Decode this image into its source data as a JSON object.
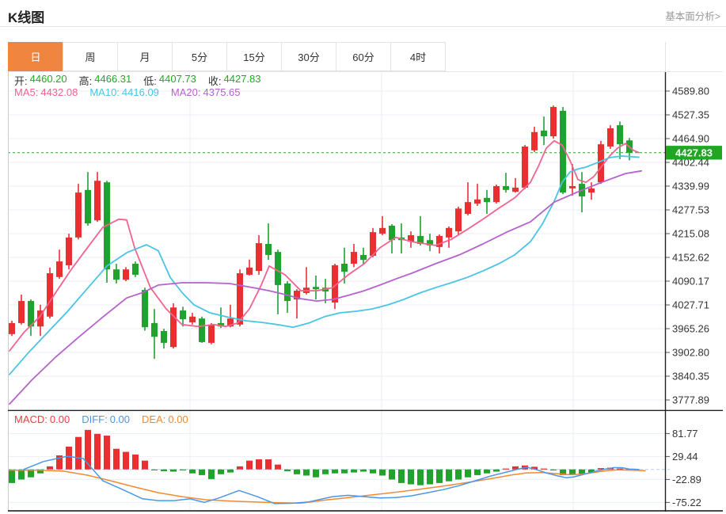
{
  "header": {
    "title": "K线图",
    "link": "基本面分析>"
  },
  "tabs": {
    "items": [
      {
        "id": "daily",
        "label": "日",
        "active": true
      },
      {
        "id": "weekly",
        "label": "周",
        "active": false
      },
      {
        "id": "monthly",
        "label": "月",
        "active": false
      },
      {
        "id": "5min",
        "label": "5分",
        "active": false
      },
      {
        "id": "15min",
        "label": "15分",
        "active": false
      },
      {
        "id": "30min",
        "label": "30分",
        "active": false
      },
      {
        "id": "60min",
        "label": "60分",
        "active": false
      },
      {
        "id": "4hour",
        "label": "4时",
        "active": false
      }
    ]
  },
  "overlay": {
    "ohlc": [
      {
        "label": "开:",
        "value": "4460.20"
      },
      {
        "label": "高:",
        "value": "4466.31"
      },
      {
        "label": "低:",
        "value": "4407.73"
      },
      {
        "label": "收:",
        "value": "4427.83"
      }
    ],
    "ma": [
      {
        "label": "MA5:",
        "value": "4432.08"
      },
      {
        "label": "MA10:",
        "value": "4416.09"
      },
      {
        "label": "MA20:",
        "value": "4375.65"
      }
    ],
    "macd": [
      {
        "label": "MACD:",
        "value": "0.00"
      },
      {
        "label": "DIFF:",
        "value": "0.00"
      },
      {
        "label": "DEA:",
        "value": "0.00"
      }
    ]
  },
  "colors": {
    "up": "#e93030",
    "down": "#1fa32b",
    "ma5": "#f2638f",
    "ma10": "#49c4e4",
    "ma20": "#b562cc",
    "diff": "#4a97ea",
    "dea": "#f28a33",
    "macd_label": "#e94040",
    "ohlc_value": "#22a822",
    "price_tag_bg": "#21a621",
    "price_line": "#2ca52c",
    "tab_active_bg": "#f0853f",
    "zero_line": "#b5d2ee",
    "grid": "#e9eef6"
  },
  "chart_data": {
    "type": "candlestick",
    "title": "K线图",
    "legend_position": "top-left-overlay",
    "grid": true,
    "main": {
      "y_ticks": [
        4589.8,
        4527.35,
        4464.9,
        4402.44,
        4339.99,
        4277.53,
        4215.08,
        4152.62,
        4090.17,
        4027.71,
        3965.26,
        3902.8,
        3840.35,
        3777.89
      ],
      "ylim": [
        3745,
        4612
      ],
      "last_price": 4427.83,
      "last_price_label": "4427.83",
      "ohlc_current": {
        "open": 4460.2,
        "high": 4466.31,
        "low": 4407.73,
        "close": 4427.83
      },
      "ma_values": {
        "ma5": 4432.08,
        "ma10": 4416.09,
        "ma20": 4375.65
      },
      "candles": [
        [
          3951,
          3986,
          3946,
          3980
        ],
        [
          3980,
          4055,
          3976,
          4038
        ],
        [
          4038,
          4042,
          3946,
          3971
        ],
        [
          3971,
          4028,
          3946,
          4013
        ],
        [
          3997,
          4126,
          3992,
          4111
        ],
        [
          4101,
          4173,
          4096,
          4142
        ],
        [
          4132,
          4215,
          4121,
          4205
        ],
        [
          4205,
          4346,
          4200,
          4323
        ],
        [
          4330,
          4377,
          4236,
          4242
        ],
        [
          4250,
          4377,
          4246,
          4354
        ],
        [
          4350,
          4354,
          4086,
          4121
        ],
        [
          4121,
          4136,
          4084,
          4094
        ],
        [
          4094,
          4127,
          4090,
          4121
        ],
        [
          4136,
          4142,
          4101,
          4107
        ],
        [
          4067,
          4073,
          3960,
          3969
        ],
        [
          3980,
          4017,
          3886,
          3944
        ],
        [
          3959,
          3965,
          3913,
          3928
        ],
        [
          3917,
          4032,
          3913,
          4021
        ],
        [
          4013,
          4023,
          3971,
          3990
        ],
        [
          3982,
          4007,
          3976,
          3997
        ],
        [
          3992,
          3997,
          3928,
          3930
        ],
        [
          3928,
          3980,
          3924,
          3976
        ],
        [
          3980,
          4021,
          3967,
          3971
        ],
        [
          3971,
          4028,
          3969,
          3992
        ],
        [
          3976,
          4121,
          3971,
          4111
        ],
        [
          4107,
          4147,
          4105,
          4126
        ],
        [
          4117,
          4211,
          4107,
          4190
        ],
        [
          4188,
          4242,
          4146,
          4159
        ],
        [
          4167,
          4173,
          4003,
          4080
        ],
        [
          4084,
          4090,
          4007,
          4038
        ],
        [
          4042,
          4069,
          3992,
          4065
        ],
        [
          4059,
          4127,
          4055,
          4073
        ],
        [
          4075,
          4105,
          4042,
          4069
        ],
        [
          4073,
          4096,
          4032,
          4063
        ],
        [
          4034,
          4136,
          4017,
          4132
        ],
        [
          4136,
          4178,
          4084,
          4115
        ],
        [
          4136,
          4188,
          4127,
          4167
        ],
        [
          4159,
          4178,
          4136,
          4146
        ],
        [
          4157,
          4230,
          4153,
          4219
        ],
        [
          4215,
          4261,
          4211,
          4230
        ],
        [
          4236,
          4240,
          4163,
          4198
        ],
        [
          4205,
          4242,
          4163,
          4198
        ],
        [
          4194,
          4221,
          4178,
          4211
        ],
        [
          4209,
          4261,
          4184,
          4188
        ],
        [
          4198,
          4215,
          4169,
          4184
        ],
        [
          4180,
          4213,
          4163,
          4209
        ],
        [
          4205,
          4234,
          4178,
          4230
        ],
        [
          4221,
          4286,
          4211,
          4281
        ],
        [
          4267,
          4350,
          4263,
          4298
        ],
        [
          4294,
          4346,
          4288,
          4305
        ],
        [
          4309,
          4330,
          4267,
          4298
        ],
        [
          4298,
          4344,
          4294,
          4340
        ],
        [
          4340,
          4375,
          4323,
          4330
        ],
        [
          4325,
          4361,
          4323,
          4336
        ],
        [
          4336,
          4448,
          4332,
          4444
        ],
        [
          4434,
          4496,
          4429,
          4482
        ],
        [
          4486,
          4523,
          4448,
          4471
        ],
        [
          4471,
          4552,
          4465,
          4548
        ],
        [
          4538,
          4548,
          4319,
          4323
        ],
        [
          4334,
          4398,
          4315,
          4340
        ],
        [
          4346,
          4377,
          4271,
          4313
        ],
        [
          4323,
          4350,
          4304,
          4334
        ],
        [
          4350,
          4459,
          4346,
          4450
        ],
        [
          4444,
          4500,
          4438,
          4492
        ],
        [
          4500,
          4510,
          4411,
          4450
        ],
        [
          4460.2,
          4466.31,
          4407.73,
          4427.83
        ]
      ],
      "ma5": [
        [
          2,
          3907
        ],
        [
          20,
          3955
        ],
        [
          40,
          3996
        ],
        [
          60,
          4059
        ],
        [
          80,
          4121
        ],
        [
          100,
          4177
        ],
        [
          120,
          4232
        ],
        [
          140,
          4253
        ],
        [
          150,
          4251
        ],
        [
          160,
          4178
        ],
        [
          180,
          4073
        ],
        [
          200,
          4017
        ],
        [
          220,
          3976
        ],
        [
          240,
          3971
        ],
        [
          260,
          3976
        ],
        [
          275,
          3971
        ],
        [
          290,
          3980
        ],
        [
          305,
          4017
        ],
        [
          320,
          4080
        ],
        [
          330,
          4130
        ],
        [
          350,
          4107
        ],
        [
          370,
          4065
        ],
        [
          390,
          4065
        ],
        [
          410,
          4073
        ],
        [
          430,
          4107
        ],
        [
          450,
          4136
        ],
        [
          470,
          4178
        ],
        [
          490,
          4205
        ],
        [
          510,
          4194
        ],
        [
          540,
          4184
        ],
        [
          560,
          4200
        ],
        [
          580,
          4226
        ],
        [
          600,
          4253
        ],
        [
          620,
          4282
        ],
        [
          640,
          4309
        ],
        [
          660,
          4350
        ],
        [
          670,
          4392
        ],
        [
          680,
          4440
        ],
        [
          690,
          4459
        ],
        [
          700,
          4448
        ],
        [
          710,
          4407
        ],
        [
          720,
          4357
        ],
        [
          730,
          4350
        ],
        [
          740,
          4365
        ],
        [
          750,
          4392
        ],
        [
          760,
          4419
        ],
        [
          770,
          4440
        ],
        [
          780,
          4452
        ],
        [
          790,
          4434
        ],
        [
          797,
          4428
        ]
      ],
      "ma10": [
        [
          2,
          3845
        ],
        [
          25,
          3900
        ],
        [
          50,
          3955
        ],
        [
          75,
          4010
        ],
        [
          100,
          4070
        ],
        [
          125,
          4130
        ],
        [
          150,
          4165
        ],
        [
          175,
          4186
        ],
        [
          190,
          4170
        ],
        [
          205,
          4100
        ],
        [
          220,
          4060
        ],
        [
          235,
          4028
        ],
        [
          255,
          4007
        ],
        [
          275,
          3997
        ],
        [
          300,
          3986
        ],
        [
          320,
          3982
        ],
        [
          340,
          3976
        ],
        [
          360,
          3969
        ],
        [
          380,
          3980
        ],
        [
          400,
          3997
        ],
        [
          420,
          4007
        ],
        [
          440,
          4011
        ],
        [
          460,
          4017
        ],
        [
          480,
          4028
        ],
        [
          500,
          4042
        ],
        [
          520,
          4059
        ],
        [
          540,
          4073
        ],
        [
          560,
          4086
        ],
        [
          580,
          4100
        ],
        [
          600,
          4117
        ],
        [
          620,
          4136
        ],
        [
          640,
          4159
        ],
        [
          660,
          4194
        ],
        [
          675,
          4240
        ],
        [
          690,
          4300
        ],
        [
          700,
          4350
        ],
        [
          710,
          4377
        ],
        [
          720,
          4385
        ],
        [
          730,
          4390
        ],
        [
          745,
          4402
        ],
        [
          760,
          4415
        ],
        [
          775,
          4419
        ],
        [
          790,
          4417
        ],
        [
          797,
          4416
        ]
      ],
      "ma20": [
        [
          2,
          3767
        ],
        [
          30,
          3830
        ],
        [
          60,
          3890
        ],
        [
          90,
          3944
        ],
        [
          120,
          3996
        ],
        [
          150,
          4046
        ],
        [
          170,
          4060
        ],
        [
          190,
          4080
        ],
        [
          220,
          4086
        ],
        [
          250,
          4086
        ],
        [
          280,
          4084
        ],
        [
          310,
          4073
        ],
        [
          330,
          4065
        ],
        [
          350,
          4055
        ],
        [
          370,
          4044
        ],
        [
          390,
          4038
        ],
        [
          410,
          4042
        ],
        [
          430,
          4053
        ],
        [
          450,
          4065
        ],
        [
          470,
          4080
        ],
        [
          490,
          4096
        ],
        [
          510,
          4111
        ],
        [
          540,
          4136
        ],
        [
          570,
          4159
        ],
        [
          600,
          4188
        ],
        [
          630,
          4219
        ],
        [
          660,
          4246
        ],
        [
          690,
          4298
        ],
        [
          720,
          4325
        ],
        [
          750,
          4350
        ],
        [
          780,
          4373
        ],
        [
          800,
          4380
        ]
      ]
    },
    "macd": {
      "y_ticks": [
        81.77,
        29.44,
        -22.89,
        -75.22
      ],
      "values": {
        "macd": 0.0,
        "diff": 0.0,
        "dea": 0.0
      },
      "bars": [
        -31,
        -23,
        -18,
        -9,
        7,
        32,
        52,
        74,
        90,
        81,
        77,
        47,
        40,
        34,
        20,
        -2,
        -4,
        -5,
        -2,
        -9,
        -13,
        -22,
        -11,
        -7,
        7,
        20,
        23,
        23,
        11,
        -4,
        -11,
        -14,
        -18,
        -11,
        -9,
        -9,
        -7,
        -5,
        -9,
        -14,
        -23,
        -31,
        -34,
        -36,
        -34,
        -31,
        -27,
        -23,
        -18,
        -13,
        -9,
        -5,
        2,
        7,
        9,
        6,
        2,
        -2,
        -13,
        -12,
        -10,
        -7,
        3,
        4,
        2,
        1
      ],
      "diff": [
        [
          20,
          0
        ],
        [
          45,
          18
        ],
        [
          75,
          30
        ],
        [
          95,
          25
        ],
        [
          120,
          -26
        ],
        [
          145,
          -46
        ],
        [
          170,
          -67
        ],
        [
          190,
          -71
        ],
        [
          210,
          -71
        ],
        [
          230,
          -67
        ],
        [
          248,
          -75
        ],
        [
          265,
          -66
        ],
        [
          292,
          -48
        ],
        [
          315,
          -62
        ],
        [
          337,
          -78
        ],
        [
          360,
          -77
        ],
        [
          380,
          -74
        ],
        [
          410,
          -62
        ],
        [
          430,
          -59
        ],
        [
          450,
          -62
        ],
        [
          470,
          -65
        ],
        [
          490,
          -64
        ],
        [
          510,
          -60
        ],
        [
          530,
          -53
        ],
        [
          550,
          -46
        ],
        [
          570,
          -37
        ],
        [
          590,
          -26
        ],
        [
          610,
          -15
        ],
        [
          630,
          -6
        ],
        [
          645,
          1
        ],
        [
          655,
          5
        ],
        [
          665,
          1
        ],
        [
          680,
          -8
        ],
        [
          695,
          -15
        ],
        [
          705,
          -19
        ],
        [
          715,
          -17
        ],
        [
          730,
          -10
        ],
        [
          745,
          -3
        ],
        [
          755,
          1
        ],
        [
          765,
          4
        ],
        [
          775,
          4
        ],
        [
          785,
          1
        ],
        [
          797,
          0
        ]
      ],
      "dea": [
        [
          2,
          -2
        ],
        [
          40,
          -2
        ],
        [
          70,
          -4
        ],
        [
          100,
          -13
        ],
        [
          130,
          -26
        ],
        [
          160,
          -40
        ],
        [
          190,
          -53
        ],
        [
          220,
          -62
        ],
        [
          250,
          -69
        ],
        [
          280,
          -72
        ],
        [
          310,
          -74
        ],
        [
          340,
          -76
        ],
        [
          370,
          -77
        ],
        [
          400,
          -70
        ],
        [
          430,
          -64
        ],
        [
          460,
          -58
        ],
        [
          490,
          -52
        ],
        [
          520,
          -45
        ],
        [
          550,
          -38
        ],
        [
          580,
          -30
        ],
        [
          610,
          -21
        ],
        [
          635,
          -13
        ],
        [
          655,
          -8
        ],
        [
          675,
          -7
        ],
        [
          695,
          -10
        ],
        [
          710,
          -12
        ],
        [
          725,
          -11
        ],
        [
          740,
          -7
        ],
        [
          755,
          -3
        ],
        [
          770,
          -1
        ],
        [
          790,
          -2
        ],
        [
          805,
          -3
        ]
      ]
    }
  }
}
